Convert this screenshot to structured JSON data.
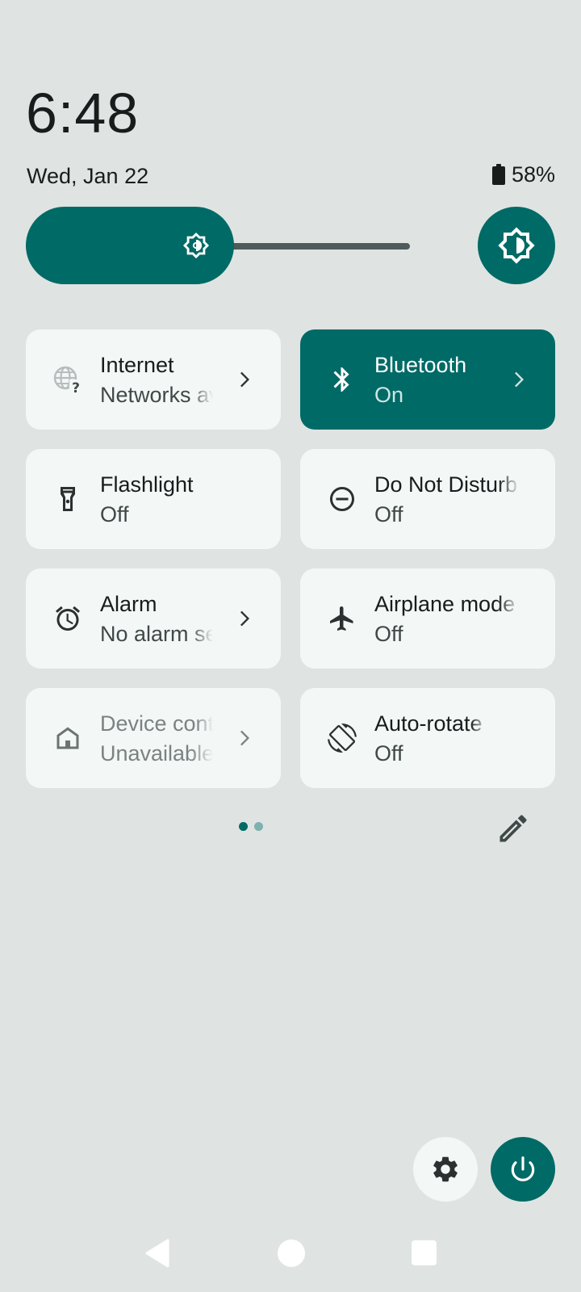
{
  "status": {
    "time": "6:48",
    "date": "Wed, Jan 22",
    "battery": "58%"
  },
  "brightness": {
    "level": 0.5,
    "icon": "brightness-icon"
  },
  "tiles": [
    {
      "title": "Internet",
      "subtitle": "Networks available",
      "icon": "internet-question-icon",
      "state": "inactive",
      "has_chevron": true
    },
    {
      "title": "Bluetooth",
      "subtitle": "On",
      "icon": "bluetooth-icon",
      "state": "active",
      "has_chevron": true
    },
    {
      "title": "Flashlight",
      "subtitle": "Off",
      "icon": "flashlight-icon",
      "state": "inactive",
      "has_chevron": false
    },
    {
      "title": "Do Not Disturb",
      "subtitle": "Off",
      "icon": "do-not-disturb-icon",
      "state": "inactive",
      "has_chevron": false
    },
    {
      "title": "Alarm",
      "subtitle": "No alarm set",
      "icon": "alarm-icon",
      "state": "inactive",
      "has_chevron": true
    },
    {
      "title": "Airplane mode",
      "subtitle": "Off",
      "icon": "airplane-icon",
      "state": "inactive",
      "has_chevron": false
    },
    {
      "title": "Device controls",
      "subtitle": "Unavailable",
      "icon": "home-icon",
      "state": "unavailable",
      "has_chevron": true
    },
    {
      "title": "Auto-rotate",
      "subtitle": "Off",
      "icon": "auto-rotate-icon",
      "state": "inactive",
      "has_chevron": false
    }
  ],
  "pager": {
    "pages": 2,
    "current": 1
  },
  "colors": {
    "accent": "#006a66",
    "background": "#dfe4e2",
    "tile": "#f3f7f6",
    "dot_active": "#006a66",
    "dot_inactive": "#7fb1ae"
  }
}
